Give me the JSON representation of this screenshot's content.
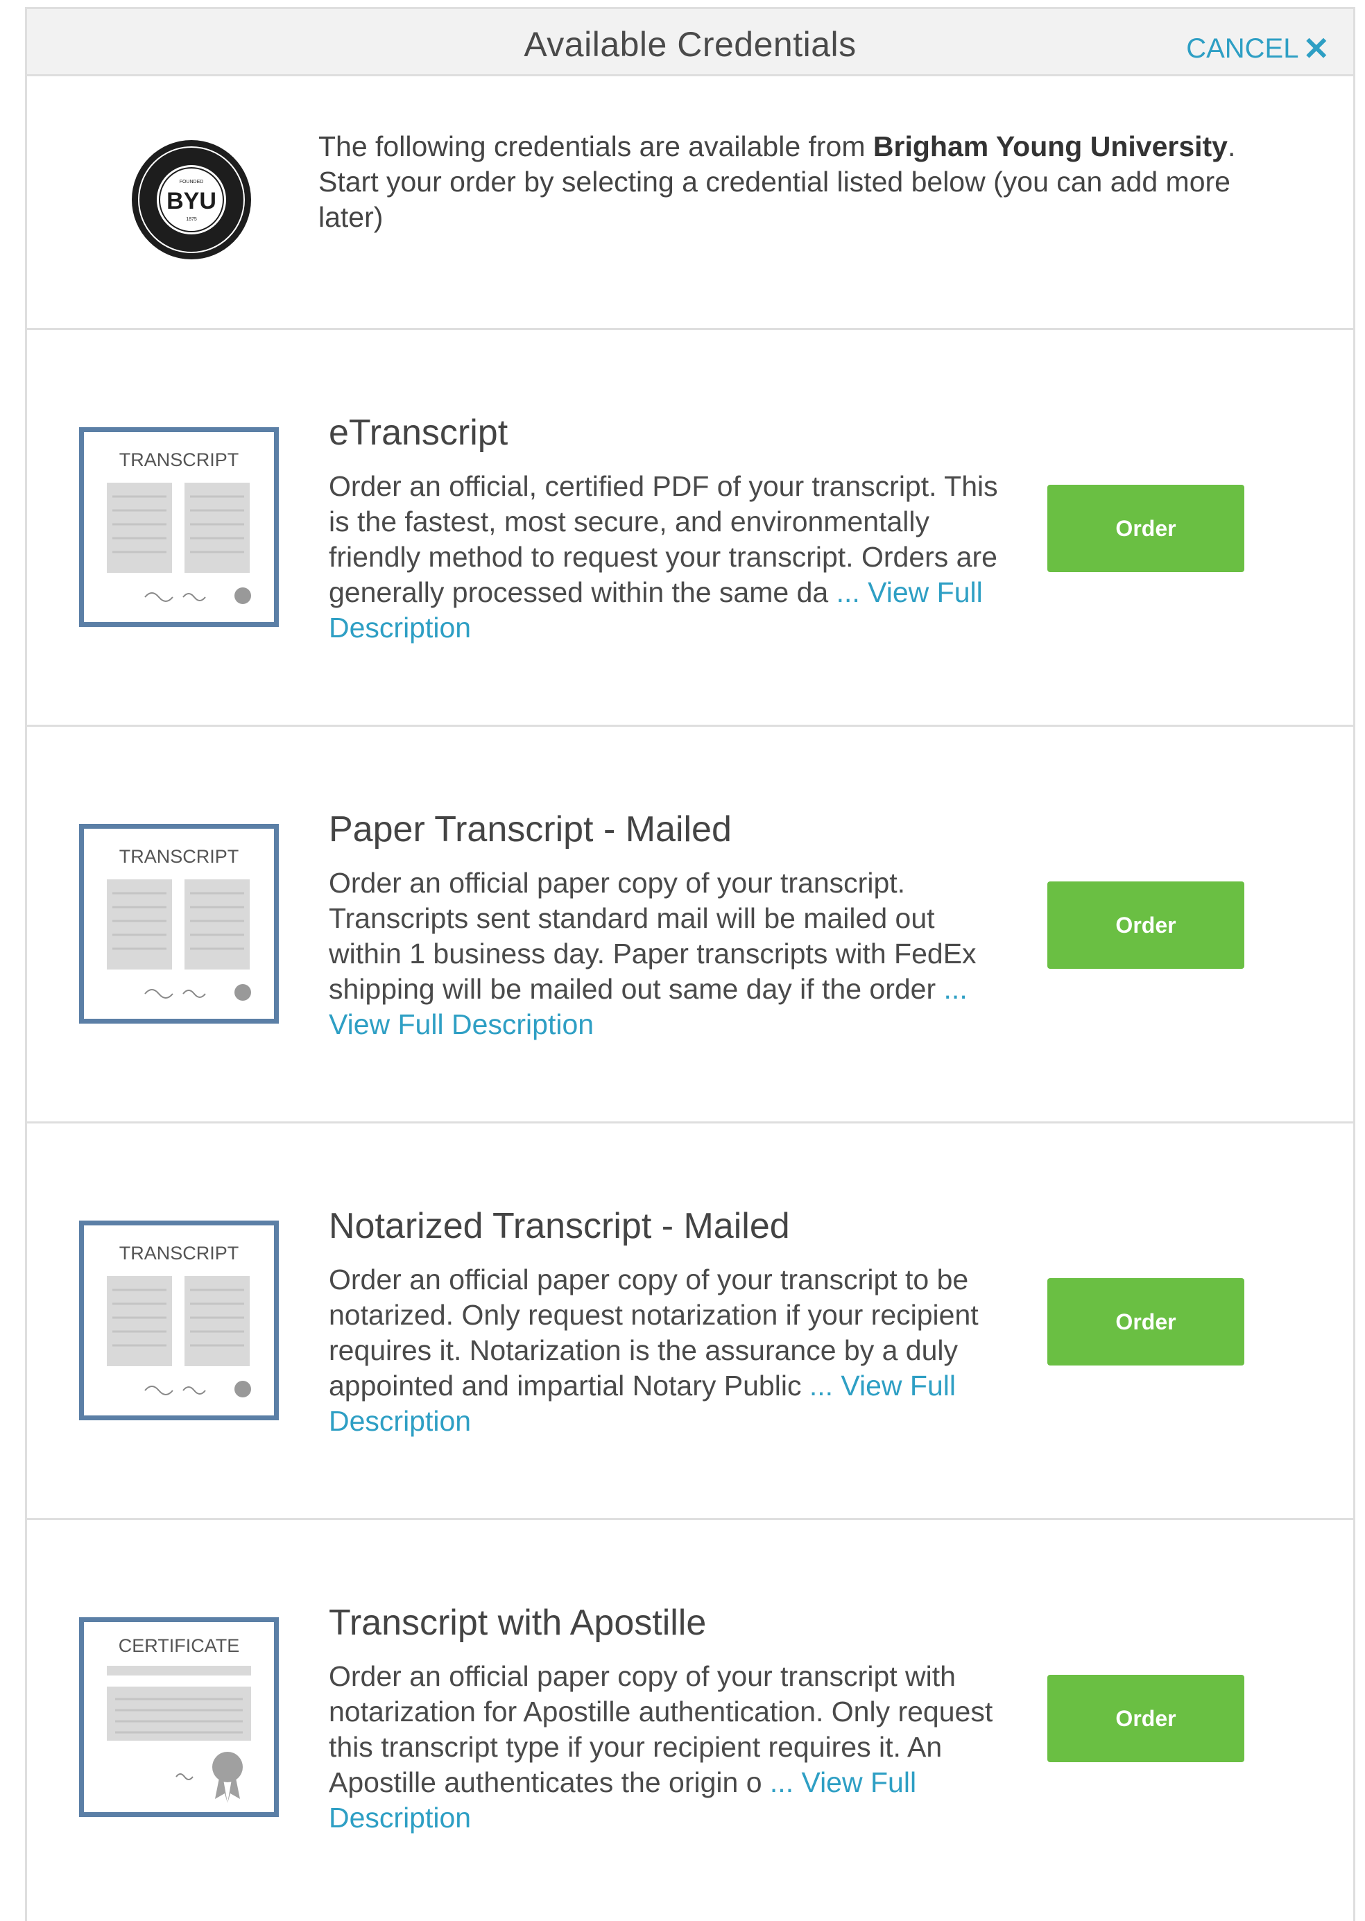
{
  "header": {
    "title": "Available Credentials",
    "cancel_label": "CANCEL",
    "cancel_icon": "close-icon"
  },
  "intro": {
    "seal_text": "BYU",
    "text_before": "The following credentials are available from ",
    "institution": "Brigham Young University",
    "text_after": ". Start your order by selecting a credential listed below (you can add more later)"
  },
  "credentials": [
    {
      "title": "eTranscript",
      "icon_label": "TRANSCRIPT",
      "description": "Order an official, certified PDF of your transcript. This is the fastest, most secure, and environmentally friendly method to request your transcript. Orders are generally processed within the same da",
      "view_link": " ... View Full Description",
      "order_label": "Order"
    },
    {
      "title": "Paper Transcript - Mailed",
      "icon_label": "TRANSCRIPT",
      "description": "Order an official paper copy of your transcript. Transcripts sent standard mail will be mailed out within 1 business day. Paper transcripts with FedEx shipping will be mailed out same day if the order",
      "view_link": " ... View Full Description",
      "order_label": "Order"
    },
    {
      "title": "Notarized Transcript - Mailed",
      "icon_label": "TRANSCRIPT",
      "description": "Order an official paper copy of your transcript to be notarized. Only request notarization if your recipient requires it. Notarization is the assurance by a duly appointed and impartial Notary Public",
      "view_link": " ... View Full Description",
      "order_label": "Order"
    },
    {
      "title": "Transcript with Apostille",
      "icon_label": "CERTIFICATE",
      "description": "Order an official paper copy of your transcript with notarization for Apostille authentication. Only request this transcript type if your recipient requires it. An Apostille authenticates the origin o",
      "view_link": " ... View Full Description",
      "order_label": "Order"
    }
  ],
  "colors": {
    "accent_link": "#2e9fc4",
    "order_button": "#6abf43",
    "icon_border": "#5b7fa6"
  }
}
